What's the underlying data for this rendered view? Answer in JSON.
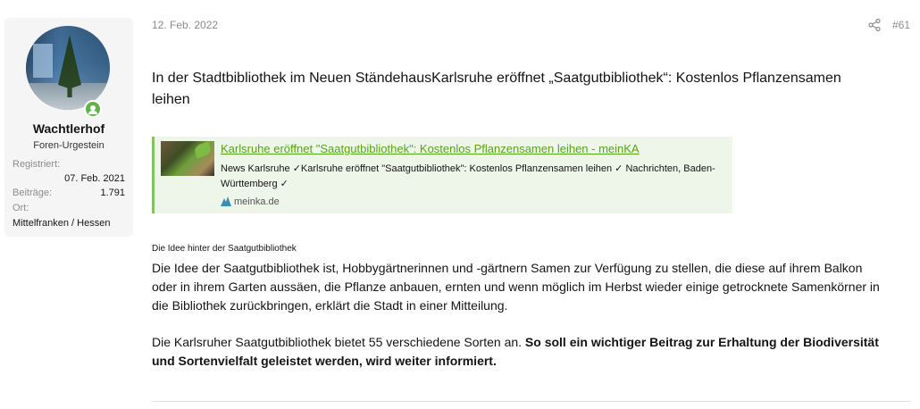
{
  "user": {
    "name": "Wachtlerhof",
    "title": "Foren-Urgestein",
    "registered_label": "Registriert:",
    "registered_value": "07. Feb. 2021",
    "posts_label": "Beiträge:",
    "posts_value": "1.791",
    "location_label": "Ort:",
    "location_value": "Mittelfranken / Hessen",
    "status_color": "#63b14a"
  },
  "post": {
    "date": "12. Feb. 2022",
    "number": "#61",
    "share_icon": "share-icon",
    "heading": "In der Stadtbibliothek im Neuen StändehausKarlsruhe eröffnet „Saatgutbibliothek“: Kostenlos Pflanzensamen leihen",
    "embed": {
      "title": "Karlsruhe eröffnet \"Saatgutbibliothek\": Kostenlos Pflanzensamen leihen - meinKA",
      "description": "News Karlsruhe ✓Karlsruhe eröffnet \"Saatgutbibliothek\": Kostenlos Pflanzensamen leihen ✓ Nachrichten, Baden-Württemberg ✓",
      "site": "meinka.de",
      "accent": "#88c06a",
      "link_color": "#54a51c"
    },
    "subheading": "Die Idee hinter der Saatgutbibliothek",
    "paragraph1": "Die Idee der Saatgutbibliothek ist, Hobbygärtnerinnen und -gärtnern Samen zur Verfügung zu stellen, die diese auf ihrem Balkon oder in ihrem Garten aussäen, die Pflanze anbauen, ernten und wenn möglich im Herbst wieder einige getrocknete Samenkörner in die Bibliothek zurückbringen, erklärt die Stadt in einer Mitteilung.",
    "paragraph2_plain": "Die Karlsruher Saatgutbibliothek bietet 55 verschiedene Sorten an. ",
    "paragraph2_bold": "So soll ein wichtiger Beitrag zur Erhaltung der Biodiversität und Sortenvielfalt geleistet werden, wird weiter informiert."
  }
}
